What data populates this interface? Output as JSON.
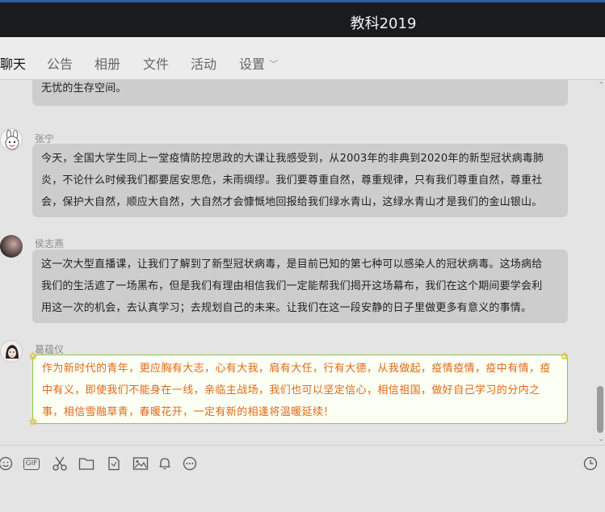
{
  "window": {
    "title": "教科2019"
  },
  "tabs": [
    {
      "label": "聊天",
      "active": true
    },
    {
      "label": "公告"
    },
    {
      "label": "相册"
    },
    {
      "label": "文件"
    },
    {
      "label": "活动"
    },
    {
      "label": "设置"
    }
  ],
  "messages": [
    {
      "sender": "",
      "lines": [
        "无忧的生存空间。"
      ]
    },
    {
      "sender": "张宁",
      "lines": [
        "今天，全国大学生同上一堂疫情防控思政的大课让我感受到，从2003年的非典到2020年的新型冠状病毒肺",
        "炎，不论什么时候我们都要居安思危，未雨绸缪。我们要尊重自然，尊重规律，只有我们尊重自然，尊重社",
        "会，保护大自然，顺应大自然，大自然才会慷慨地回报给我们绿水青山，这绿水青山才是我们的金山银山。"
      ]
    },
    {
      "sender": "侯志燕",
      "lines": [
        "这一次大型直播课，让我们了解到了新型冠状病毒，是目前已知的第七种可以感染人的冠状病毒。这场病给",
        "我们的生活遮了一场黑布，但是我们有理由相信我们一定能帮我们揭开这场幕布，我们在这个期间要学会利",
        "用这一次的机会，去认真学习；去规划自己的未来。让我们在这一段安静的日子里做更多有意义的事情。"
      ]
    },
    {
      "sender": "葛蕴仪",
      "lines": [
        "作为新时代的青年，更应胸有大志，心有大我，肩有大任，行有大德，从我做起，疫情疫情，疫中有情，疫",
        "中有义，即使我们不能身在一线，亲临主战场，我们也可以坚定信心，相信祖国，做好自己学习的分内之",
        "事，相信雪融草青，春暖花开，一定有新的相逢将温暖延续！"
      ]
    }
  ],
  "toolbar": {
    "icons": [
      "emoji-icon",
      "gif-icon",
      "scissors-icon",
      "folder-icon",
      "file-icon",
      "image-icon",
      "bell-icon",
      "more-icon",
      "history-icon"
    ],
    "gif_label": "GIF"
  },
  "colors": {
    "title_bar": "#1a1b1e",
    "accent_top": "#2a5fa8",
    "bubble": "#cdcdcd",
    "special_border": "#8cc94a",
    "special_text": "#e0691a"
  }
}
